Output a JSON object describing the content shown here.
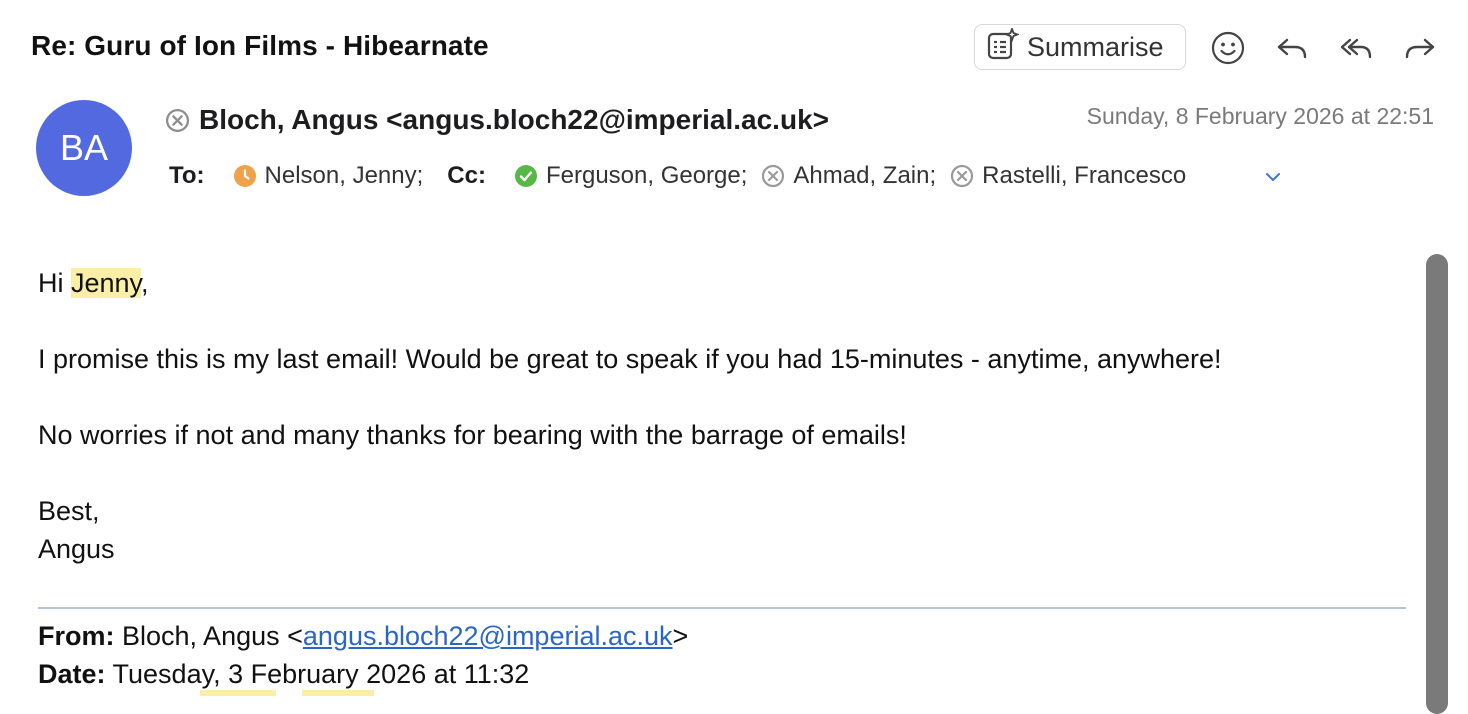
{
  "header": {
    "subject": "Re: Guru of Ion Films - Hibearnate",
    "summarise_label": "Summarise",
    "icons": [
      "emoji-icon",
      "reply-icon",
      "reply-all-icon",
      "forward-icon"
    ]
  },
  "message": {
    "avatar_initials": "BA",
    "avatar_color": "#5369e0",
    "sender": "Bloch, Angus <angus.bloch22@imperial.ac.uk>",
    "date": "Sunday, 8 February 2026 at 22:51",
    "to_label": "To:",
    "cc_label": "Cc:",
    "to": [
      {
        "name": "Nelson, Jenny;",
        "status": "pending",
        "status_color": "#f0a24a"
      }
    ],
    "cc": [
      {
        "name": "Ferguson, George;",
        "status": "accepted",
        "status_color": "#58b847"
      },
      {
        "name": "Ahmad, Zain;",
        "status": "unknown",
        "status_color": "#9a9a9a"
      },
      {
        "name": "Rastelli, Francesco",
        "status": "unknown",
        "status_color": "#9a9a9a"
      }
    ]
  },
  "body": {
    "greeting_prefix": "Hi ",
    "greeting_name": "Jenny",
    "greeting_suffix": ",",
    "para1": "I promise this is my last email! Would be great to speak if you had 15-minutes - anytime, anywhere!",
    "para2": "No worries if not and many thanks for bearing with the barrage of emails!",
    "signoff": "Best,",
    "signature": "Angus"
  },
  "quoted": {
    "from_label": "From:",
    "from_name": " Bloch, Angus <",
    "from_email": "angus.bloch22@imperial.ac.uk",
    "from_end": ">",
    "date_label": "Date:",
    "date_value": " Tuesday, 3 February 2026 at 11:32"
  },
  "colors": {
    "highlight": "#fbefa8",
    "link": "#2a66c8",
    "expand_chevron": "#3b78d8"
  }
}
